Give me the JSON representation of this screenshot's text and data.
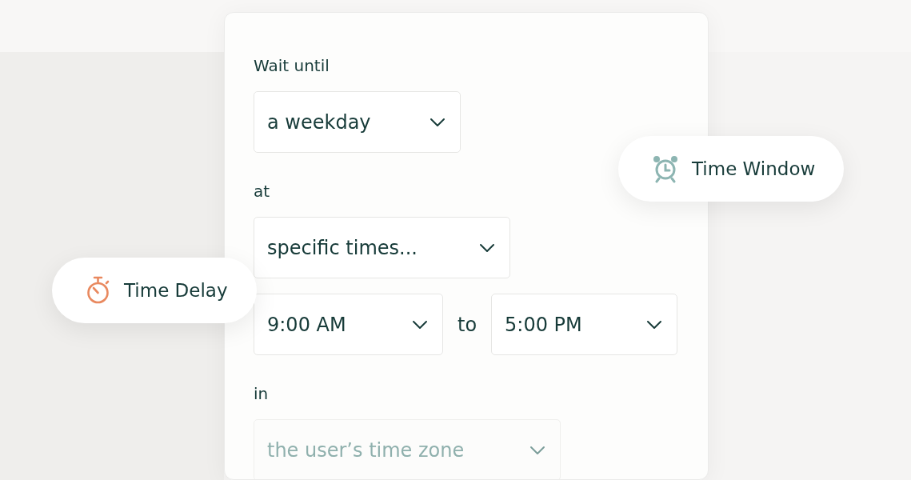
{
  "form": {
    "sections": [
      {
        "label": "Wait until",
        "fields": [
          {
            "value": "a weekday",
            "disabled": false
          }
        ]
      },
      {
        "label": "at",
        "fields": [
          {
            "value": "specific times...",
            "disabled": false
          }
        ]
      },
      {
        "fields": [
          {
            "value": "9:00 AM",
            "disabled": false
          },
          {
            "value": "5:00 PM",
            "disabled": false
          }
        ],
        "joiner": "to"
      },
      {
        "label": "in",
        "fields": [
          {
            "value": "the user’s time zone",
            "disabled": true
          }
        ]
      }
    ]
  },
  "badges": [
    {
      "kind": "delay",
      "label": "Time Delay"
    },
    {
      "kind": "window",
      "label": "Time Window"
    }
  ]
}
